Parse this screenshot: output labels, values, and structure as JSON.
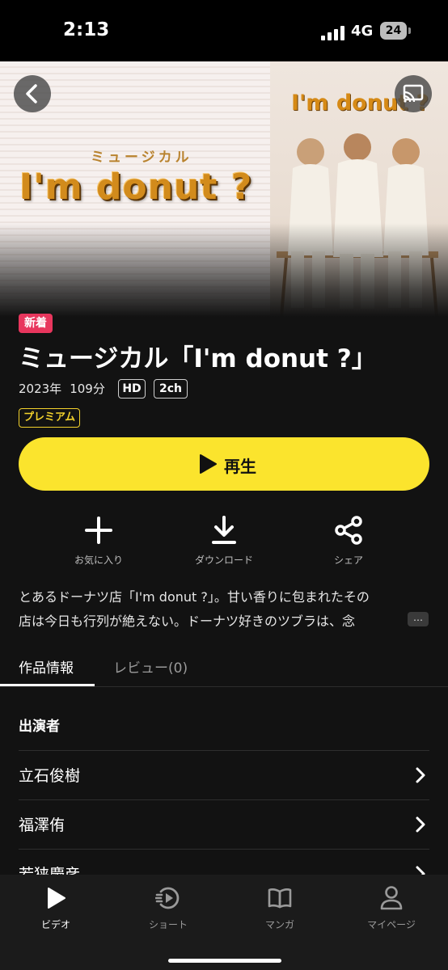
{
  "status_bar": {
    "time": "2:13",
    "network": "4G",
    "battery": "24"
  },
  "hero": {
    "subtitle": "ミュージカル",
    "logo": "I'm donut ?",
    "poster_logo": "I'm donut ?"
  },
  "header": {
    "back_icon": "chevron-left-icon",
    "cast_icon": "cast-icon"
  },
  "content": {
    "badge": "新着",
    "title": "ミュージカル「I'm donut ?」",
    "year": "2023年",
    "duration": "109分",
    "tags": [
      "HD",
      "2ch"
    ],
    "premium": "プレミアム",
    "play_label": "再生",
    "actions": [
      {
        "label": "お気に入り",
        "icon": "plus-icon"
      },
      {
        "label": "ダウンロード",
        "icon": "download-icon"
      },
      {
        "label": "シェア",
        "icon": "share-icon"
      }
    ],
    "description_line1": "とあるドーナツ店「I'm donut ?」。甘い香りに包まれたその",
    "description_line2": "店は今日も行列が絶えない。ドーナツ好きのツブラは、念",
    "more": "…"
  },
  "tabs": [
    {
      "label": "作品情報",
      "active": true
    },
    {
      "label": "レビュー(0)",
      "active": false
    }
  ],
  "cast": {
    "heading": "出演者",
    "members": [
      "立石俊樹",
      "福澤侑",
      "若狭慶彦"
    ]
  },
  "bottom_nav": [
    {
      "label": "ビデオ",
      "icon": "play-icon",
      "active": true
    },
    {
      "label": "ショート",
      "icon": "short-play-icon",
      "active": false
    },
    {
      "label": "マンガ",
      "icon": "book-icon",
      "active": false
    },
    {
      "label": "マイページ",
      "icon": "person-icon",
      "active": false
    }
  ],
  "colors": {
    "accent_yellow": "#fbe42d",
    "badge_red": "#e8365d",
    "premium_yellow": "#f3d22c",
    "background": "#121212"
  }
}
